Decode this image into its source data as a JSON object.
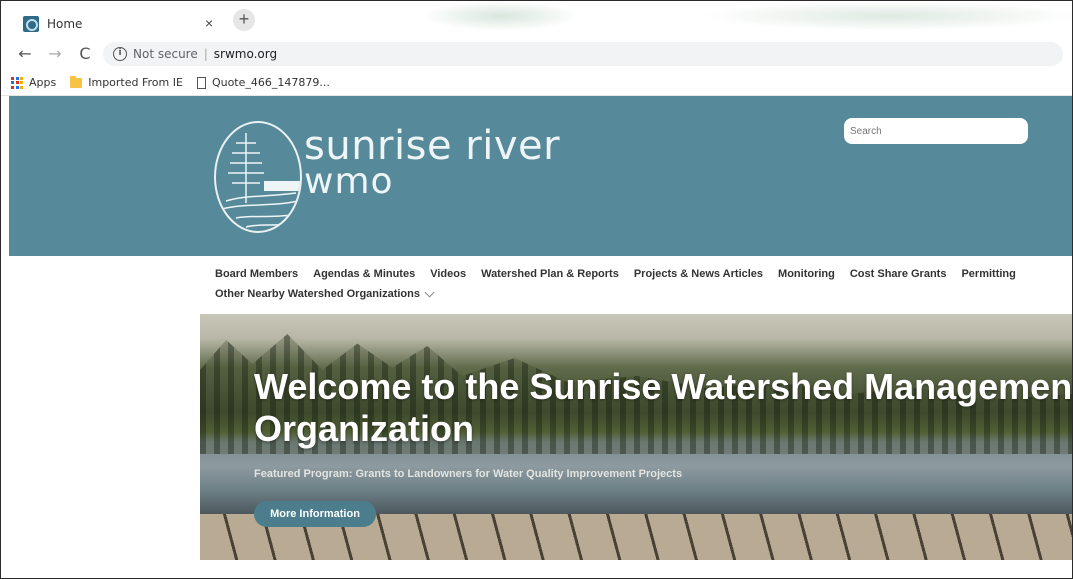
{
  "browser": {
    "tab_title": "Home",
    "tab_close": "×",
    "new_tab": "+",
    "security_label": "Not secure",
    "separator": "|",
    "url": "srwmo.org",
    "nav": {
      "back": "←",
      "forward": "→",
      "reload": "C"
    },
    "bookmarks": [
      {
        "label": "Apps",
        "icon": "apps-grid-icon"
      },
      {
        "label": "Imported From IE",
        "icon": "folder-icon"
      },
      {
        "label": "Quote_466_147879...",
        "icon": "page-icon"
      }
    ]
  },
  "site": {
    "brand_line1": "sunrise river",
    "brand_line2": "wmo",
    "search_placeholder": "Search",
    "nav": [
      "Board Members",
      "Agendas & Minutes",
      "Videos",
      "Watershed Plan & Reports",
      "Projects & News Articles",
      "Monitoring",
      "Cost Share Grants",
      "Permitting"
    ],
    "nav_more": "Other Nearby Watershed Organizations",
    "banner": {
      "title_line1": "Welcome to the Sunrise Watershed Management",
      "title_line2": "Organization",
      "subtitle": "Featured Program: Grants to Landowners for Water Quality Improvement Projects",
      "button": "More Information"
    },
    "colors": {
      "header_bg": "#568999",
      "button_bg": "#4b7d8d"
    }
  }
}
